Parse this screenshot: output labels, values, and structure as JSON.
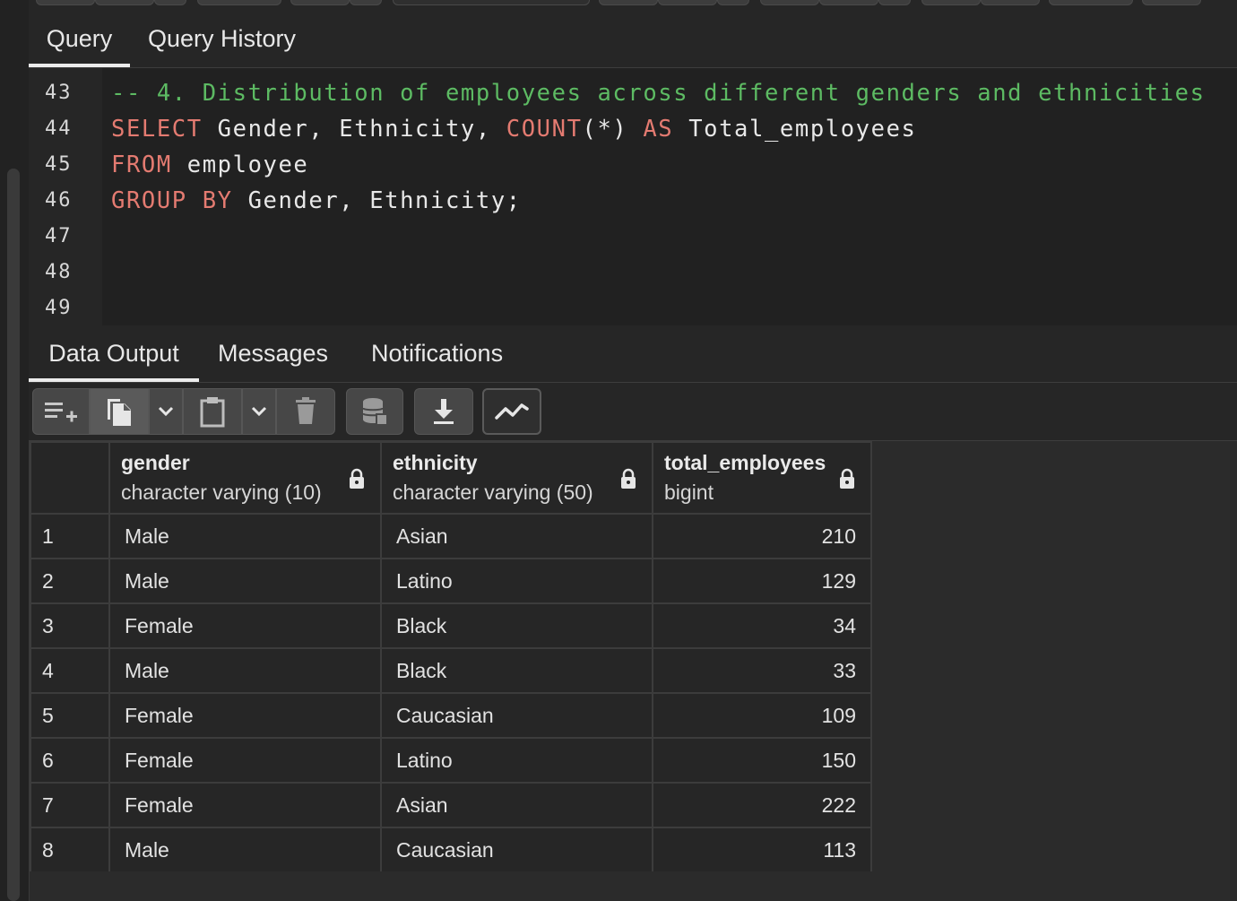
{
  "query_tabs": [
    {
      "label": "Query",
      "active": true
    },
    {
      "label": "Query History",
      "active": false
    }
  ],
  "editor": {
    "line_numbers": [
      "43",
      "44",
      "45",
      "46",
      "47",
      "48",
      "49"
    ],
    "line43_comment": "-- 4. Distribution of employees across different genders and ethnicities",
    "line44_select": "SELECT",
    "line44_cols": " Gender, Ethnicity, ",
    "line44_count": "COUNT",
    "line44_star": "(*) ",
    "line44_as": "AS",
    "line44_alias": " Total_employees",
    "line45_from": "FROM",
    "line45_table": " employee",
    "line46_group": "GROUP BY",
    "line46_cols": " Gender, Ethnicity;"
  },
  "result_tabs": [
    {
      "label": "Data Output",
      "active": true
    },
    {
      "label": "Messages",
      "active": false
    },
    {
      "label": "Notifications",
      "active": false
    }
  ],
  "toolbar_icons": [
    "add-row-icon",
    "copy-icon",
    "chevron-down-icon",
    "paste-icon",
    "chevron-down-icon",
    "delete-icon",
    "save-data-icon",
    "download-icon",
    "graph-icon"
  ],
  "grid": {
    "columns": [
      {
        "name": "gender",
        "type": "character varying (10)"
      },
      {
        "name": "ethnicity",
        "type": "character varying (50)"
      },
      {
        "name": "total_employees",
        "type": "bigint"
      }
    ],
    "rows": [
      {
        "n": "1",
        "gender": "Male",
        "ethnicity": "Asian",
        "total": "210"
      },
      {
        "n": "2",
        "gender": "Male",
        "ethnicity": "Latino",
        "total": "129"
      },
      {
        "n": "3",
        "gender": "Female",
        "ethnicity": "Black",
        "total": "34"
      },
      {
        "n": "4",
        "gender": "Male",
        "ethnicity": "Black",
        "total": "33"
      },
      {
        "n": "5",
        "gender": "Female",
        "ethnicity": "Caucasian",
        "total": "109"
      },
      {
        "n": "6",
        "gender": "Female",
        "ethnicity": "Latino",
        "total": "150"
      },
      {
        "n": "7",
        "gender": "Female",
        "ethnicity": "Asian",
        "total": "222"
      },
      {
        "n": "8",
        "gender": "Male",
        "ethnicity": "Caucasian",
        "total": "113"
      }
    ]
  },
  "colors": {
    "comment": "#5dbb63",
    "keyword": "#e47b71",
    "background": "#2b2b2b"
  }
}
